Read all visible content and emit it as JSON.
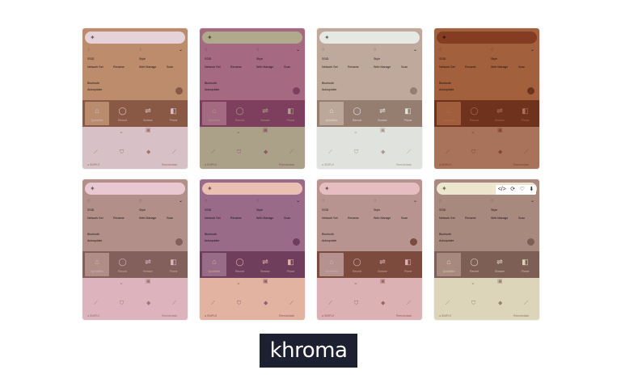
{
  "cards": [
    {
      "top": "#bd8c6c",
      "mid": "#8a5946",
      "bot": "#d8c0c7",
      "search": "#e6d3d9",
      "row": "#ba8c6f"
    },
    {
      "top": "#a56a82",
      "mid": "#7d3f5d",
      "bot": "#aba088",
      "search": "#b0a98c",
      "row": "#a36a82"
    },
    {
      "top": "#bea99c",
      "mid": "#957d70",
      "bot": "#dfe2dd",
      "search": "#e5e8e3",
      "row": "#bca89b"
    },
    {
      "top": "#a3603d",
      "mid": "#6f331d",
      "bot": "#a9725b",
      "search": "#843c23",
      "row": "#a05e3c"
    },
    {
      "top": "#b28f89",
      "mid": "#84605d",
      "bot": "#ddb3bd",
      "search": "#eac8d1",
      "row": "#b08e88"
    },
    {
      "top": "#996b88",
      "mid": "#6f3e5c",
      "bot": "#e2b3a1",
      "search": "#e9c0b1",
      "row": "#986b87"
    },
    {
      "top": "#b89490",
      "mid": "#7d4a3e",
      "bot": "#dcb1b4",
      "search": "#e6bec2",
      "row": "#b59290"
    },
    {
      "top": "#a8897e",
      "mid": "#7d5f55",
      "bot": "#ddd5ba",
      "search": "#ece6cf",
      "row": "#a8897e"
    }
  ],
  "labels": {
    "ssid": "SSID",
    "style": "Style",
    "status": "Network Set",
    "status2": "Web Manage",
    "item_a": "Rename",
    "item_b": "Scan",
    "bluetooth": "Bluetooth",
    "autoupdate": "Autoupdate",
    "tiles": [
      "Quicktiles",
      "Record",
      "Browse",
      "Phone"
    ],
    "footer_left": "● SIMPLE",
    "footer_right": "Remotedash"
  },
  "toolbar": {
    "code": "</>",
    "refresh": "⟳",
    "heart": "♡",
    "download": "⬇"
  },
  "logo": "khroma"
}
